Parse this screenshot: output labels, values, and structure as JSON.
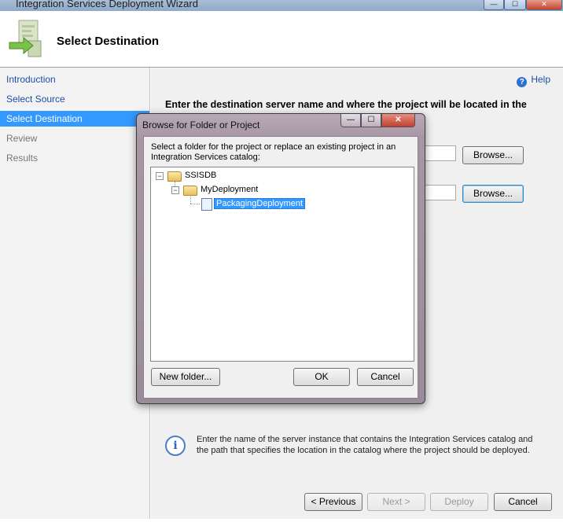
{
  "window": {
    "title": "Integration Services Deployment Wizard",
    "controls": {
      "minimize": "—",
      "maximize": "☐",
      "close": "✕"
    }
  },
  "header": {
    "title": "Select Destination"
  },
  "nav": {
    "items": [
      {
        "label": "Introduction",
        "state": "link"
      },
      {
        "label": "Select Source",
        "state": "link"
      },
      {
        "label": "Select Destination",
        "state": "selected"
      },
      {
        "label": "Review",
        "state": "disabled"
      },
      {
        "label": "Results",
        "state": "disabled"
      }
    ]
  },
  "content": {
    "help_label": "Help",
    "help_icon": "?",
    "instruction": "Enter the destination server name and where the project will be located in the",
    "browse1_label": "Browse...",
    "browse2_label": "Browse...",
    "info_icon": "i",
    "info_text": "Enter the name of the server instance that contains the Integration Services catalog and the path that specifies the location in the catalog where the project should be deployed."
  },
  "footer": {
    "previous_label": "< Previous",
    "next_label": "Next >",
    "deploy_label": "Deploy",
    "cancel_label": "Cancel"
  },
  "dialog": {
    "title": "Browse for Folder or Project",
    "controls": {
      "minimize": "—",
      "maximize": "☐",
      "close": "✕"
    },
    "prompt": "Select a folder for the project or replace an existing project in an Integration Services catalog:",
    "tree": {
      "root": {
        "label": "SSISDB",
        "expander": "−"
      },
      "folder": {
        "label": "MyDeployment",
        "expander": "−"
      },
      "project": {
        "label": "PackagingDeployment",
        "selected": true
      }
    },
    "new_folder_label": "New folder...",
    "ok_label": "OK",
    "cancel_label": "Cancel"
  },
  "colors": {
    "selection": "#3399ff",
    "link": "#1c4fa5",
    "dialog_frame": "#a797a5"
  }
}
